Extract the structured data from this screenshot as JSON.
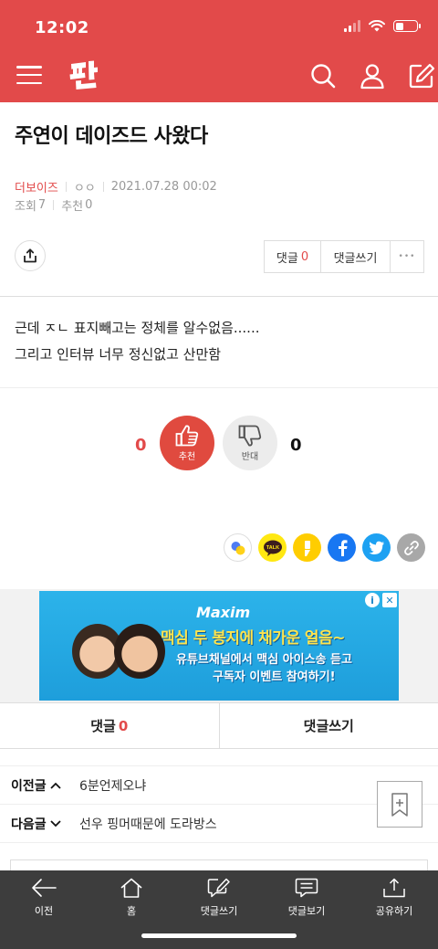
{
  "status_bar": {
    "time": "12:02"
  },
  "header": {
    "logo_text": "판",
    "icons": [
      "menu-icon",
      "search-icon",
      "user-icon",
      "compose-icon"
    ],
    "brand_color": "#e24a4a"
  },
  "post": {
    "title": "주연이 데이즈드 사왔다",
    "author": "더보이즈",
    "author_sub": "ㅇㅇ",
    "date": "2021.07.28 00:02",
    "views_label": "조회",
    "views": "7",
    "recommend_label": "추천",
    "recommend": "0",
    "content_lines": [
      "근데 ㅈㄴ 표지빼고는 정체를 알수없음......",
      "그리고 인터뷰 너무 정신없고 산만함"
    ]
  },
  "toolbar": {
    "comments_label": "댓글",
    "comments_count": "0",
    "write_comment_label": "댓글쓰기",
    "more_label": "•••"
  },
  "vote": {
    "up_count": "0",
    "up_label": "추천",
    "down_count": "0",
    "down_label": "반대"
  },
  "share_icons": [
    "talk-icon",
    "kakaotalk-icon",
    "kakaostory-icon",
    "facebook-icon",
    "twitter-icon",
    "link-icon"
  ],
  "ad": {
    "brand": "Maxim",
    "line1": "맥심 두 봉지에 채가운 얼음~",
    "line2": "유튜브채널에서 맥심 아이스송 듣고",
    "line3": "구독자 이벤트 참여하기!",
    "close_icons": [
      "info-icon",
      "close-icon"
    ]
  },
  "comment_bar": {
    "comments_label": "댓글",
    "comments_count": "0",
    "write_label": "댓글쓰기"
  },
  "navigation": {
    "prev_label": "이전글",
    "prev_title": "6분언제오냐",
    "next_label": "다음글",
    "next_title": "선우 핑머때문에 도라방스"
  },
  "bottom_bar": {
    "items": [
      {
        "label": "이전",
        "icon": "back-arrow-icon"
      },
      {
        "label": "홈",
        "icon": "home-icon"
      },
      {
        "label": "댓글쓰기",
        "icon": "write-comment-icon"
      },
      {
        "label": "댓글보기",
        "icon": "view-comments-icon"
      },
      {
        "label": "공유하기",
        "icon": "share-icon"
      }
    ]
  }
}
